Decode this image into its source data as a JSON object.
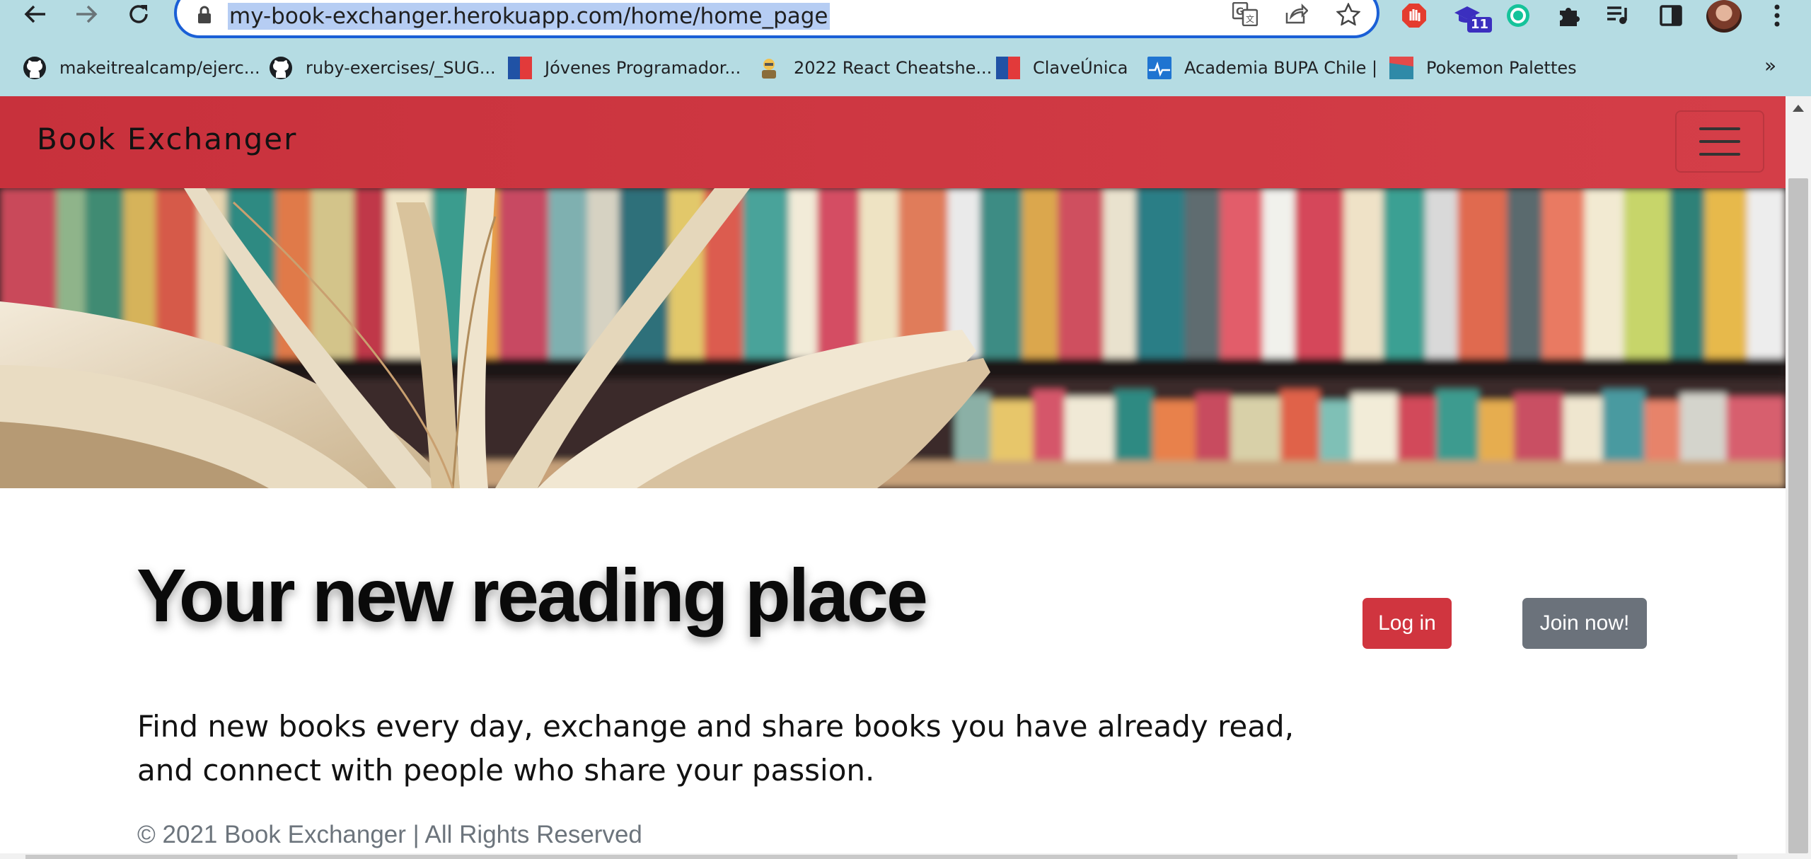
{
  "browser": {
    "url": "my-book-exchanger.herokuapp.com/home/home_page",
    "extension_badge": "11",
    "bookmarks": [
      {
        "label": "makeitrealcamp/ejerc...",
        "icon": "github-icon"
      },
      {
        "label": "ruby-exercises/_SUG...",
        "icon": "github-icon"
      },
      {
        "label": "Jóvenes Programador...",
        "icon": "chile-flag-icon"
      },
      {
        "label": "2022 React Cheatshe...",
        "icon": "react-cheatsheet-icon"
      },
      {
        "label": "ClaveÚnica",
        "icon": "chile-flag-icon"
      },
      {
        "label": "Academia BUPA Chile |",
        "icon": "bupa-icon"
      },
      {
        "label": "Pokemon Palettes",
        "icon": "pokemon-palettes-icon"
      }
    ]
  },
  "page": {
    "brand": "Book Exchanger",
    "headline": "Your new reading place",
    "login_label": "Log in",
    "join_label": "Join now!",
    "tagline": "Find new books every day, exchange and share books you have already read, and connect with people who share your passion.",
    "footer": "© 2021 Book Exchanger | All Rights Reserved"
  },
  "colors": {
    "navbar": "#d13a44",
    "login_button": "#d0353f",
    "join_button": "#6b727b",
    "chrome": "#b5dce3"
  }
}
